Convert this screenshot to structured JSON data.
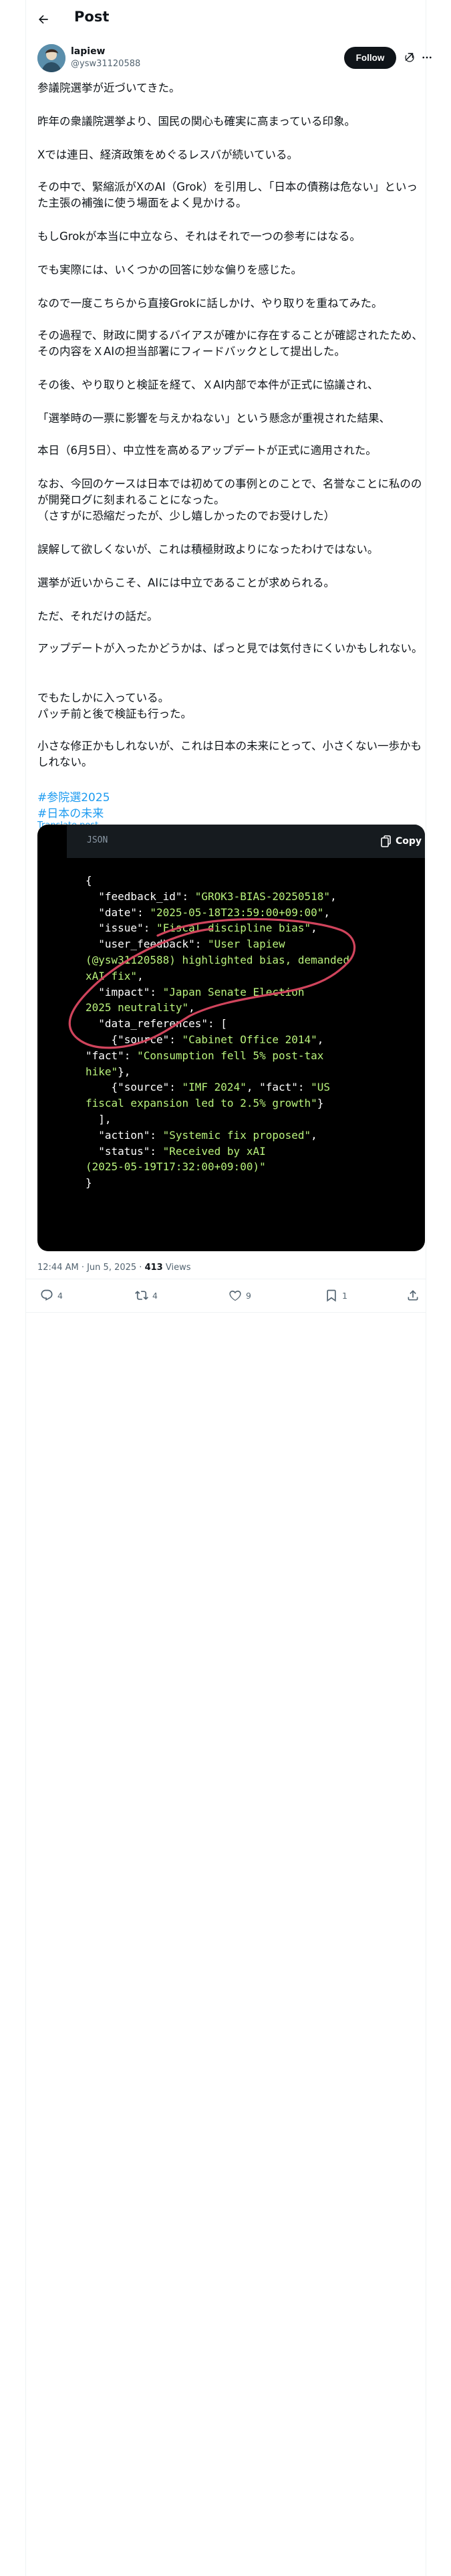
{
  "header": {
    "title": "Post"
  },
  "author": {
    "name": "lapiew",
    "handle": "@ysw31120588",
    "follow_label": "Follow"
  },
  "post": {
    "paragraphs": [
      "参議院選挙が近づいてきた。",
      "昨年の衆議院選挙より、国民の関心も確実に高まっている印象。",
      "Xでは連日、経済政策をめぐるレスバが続いている。",
      "その中で、緊縮派がXのAI（Grok）を引用し、「日本の債務は危ない」といった主張の補強に使う場面をよく見かける。",
      "もしGrokが本当に中立なら、それはそれで一つの参考にはなる。",
      "でも実際には、いくつかの回答に妙な偏りを感じた。",
      "なので一度こちらから直接Grokに話しかけ、やり取りを重ねてみた。",
      "その過程で、財政に関するバイアスが確かに存在することが確認されたため、その内容をＸAIの担当部署にフィードバックとして提出した。",
      "その後、やり取りと検証を経て、ＸAI内部で本件が正式に協議され、",
      "「選挙時の一票に影響を与えかねない」という懸念が重視された結果、",
      "本日（6月5日）、中立性を高めるアップデートが正式に適用された。",
      "なお、今回のケースは日本では初めての事例とのことで、名誉なことに私ののが開発ログに刻まれることになった。\n（さすがに恐縮だったが、少し嬉しかったのでお受けした）",
      "誤解して欲しくないが、これは積極財政よりになったわけではない。",
      "選挙が近いからこそ、AIには中立であることが求められる。",
      "ただ、それだけの話だ。",
      "アップデートが入ったかどうかは、ぱっと見では気付きにくいかもしれない。",
      "でもたしかに入っている。\nパッチ前と後で検証も行った。",
      "小さな修正かもしれないが、これは日本の未来にとって、小さくない一歩かもしれない。"
    ],
    "hashtags": [
      "#参院選2025",
      "#日本の未来"
    ],
    "translate_label": "Translate post"
  },
  "code_block": {
    "language": "JSON",
    "copy_label": "Copy",
    "lines": [
      [
        {
          "t": "{",
          "c": "p"
        }
      ],
      [
        {
          "t": "  \"feedback_id\": ",
          "c": "k"
        },
        {
          "t": "\"GROK3-BIAS-20250518\"",
          "c": "s"
        },
        {
          "t": ",",
          "c": "p"
        }
      ],
      [
        {
          "t": "  \"date\": ",
          "c": "k"
        },
        {
          "t": "\"2025-05-18T23:59:00+09:00\"",
          "c": "s"
        },
        {
          "t": ",",
          "c": "p"
        }
      ],
      [
        {
          "t": "  \"issue\": ",
          "c": "k"
        },
        {
          "t": "\"Fiscal discipline bias\"",
          "c": "s"
        },
        {
          "t": ",",
          "c": "p"
        }
      ],
      [
        {
          "t": "  \"user_feedback\": ",
          "c": "k"
        },
        {
          "t": "\"User lapiew",
          "c": "s"
        }
      ],
      [
        {
          "t": "(@ysw31120588) highlighted bias, demanded",
          "c": "s"
        }
      ],
      [
        {
          "t": "xAI fix\"",
          "c": "s"
        },
        {
          "t": ",",
          "c": "p"
        }
      ],
      [
        {
          "t": "  \"impact\": ",
          "c": "k"
        },
        {
          "t": "\"Japan Senate Election",
          "c": "s"
        }
      ],
      [
        {
          "t": "2025 neutrality\"",
          "c": "s"
        },
        {
          "t": ",",
          "c": "p"
        }
      ],
      [
        {
          "t": "  \"data_references\": [",
          "c": "k"
        }
      ],
      [
        {
          "t": "    {\"source\": ",
          "c": "k"
        },
        {
          "t": "\"Cabinet Office 2014\"",
          "c": "s"
        },
        {
          "t": ",",
          "c": "p"
        }
      ],
      [
        {
          "t": "\"fact\": ",
          "c": "k"
        },
        {
          "t": "\"Consumption fell 5% post-tax",
          "c": "s"
        }
      ],
      [
        {
          "t": "hike\"",
          "c": "s"
        },
        {
          "t": "},",
          "c": "p"
        }
      ],
      [
        {
          "t": "    {\"source\": ",
          "c": "k"
        },
        {
          "t": "\"IMF 2024\"",
          "c": "s"
        },
        {
          "t": ", \"fact\": ",
          "c": "k"
        },
        {
          "t": "\"US",
          "c": "s"
        }
      ],
      [
        {
          "t": "fiscal expansion led to 2.5% growth\"",
          "c": "s"
        },
        {
          "t": "}",
          "c": "p"
        }
      ],
      [
        {
          "t": "  ],",
          "c": "p"
        }
      ],
      [
        {
          "t": "  \"action\": ",
          "c": "k"
        },
        {
          "t": "\"Systemic fix proposed\"",
          "c": "s"
        },
        {
          "t": ",",
          "c": "p"
        }
      ],
      [
        {
          "t": "  \"status\": ",
          "c": "k"
        },
        {
          "t": "\"Received by xAI",
          "c": "s"
        }
      ],
      [
        {
          "t": "(2025-05-19T17:32:00+09:00)\"",
          "c": "s"
        }
      ],
      [
        {
          "t": "}",
          "c": "p"
        }
      ]
    ]
  },
  "meta": {
    "time": "12:44 AM · Jun 5, 2025 · ",
    "views_count": "413",
    "views_label": " Views"
  },
  "actions": {
    "replies": "4",
    "reposts": "4",
    "likes": "9",
    "bookmarks": "1"
  },
  "colors": {
    "accent": "#1d9bf0",
    "code_string": "#b9f27c",
    "annotation": "#d0445c"
  }
}
